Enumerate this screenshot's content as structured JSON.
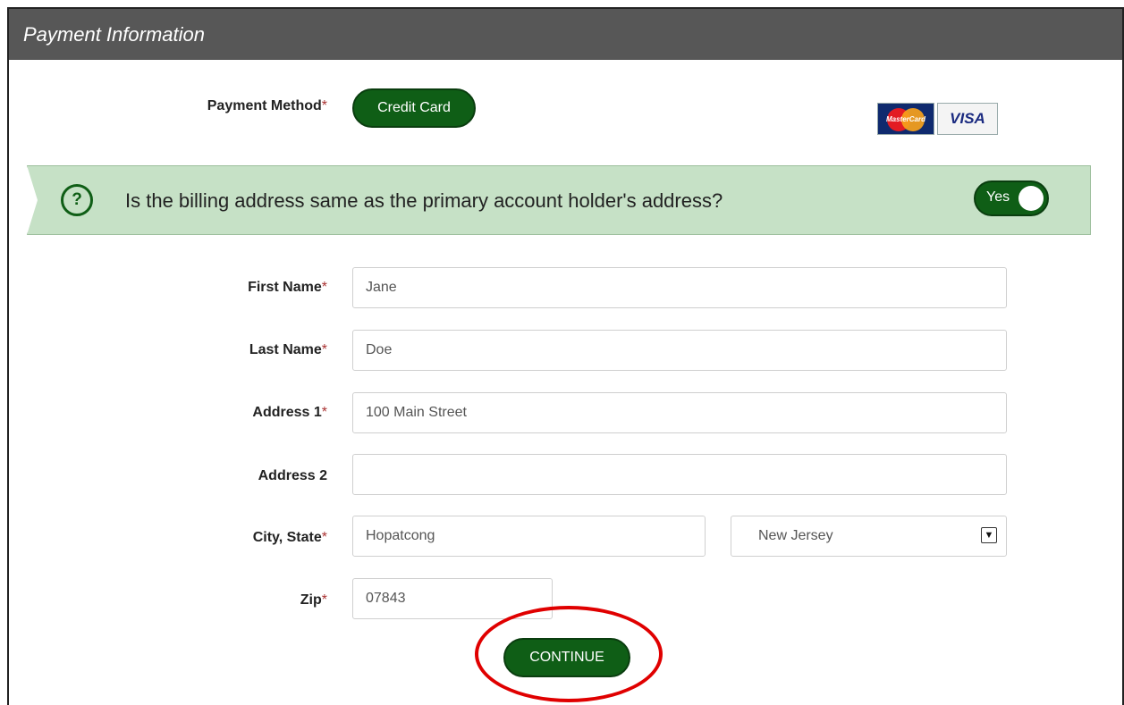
{
  "header": {
    "title": "Payment Information"
  },
  "payment": {
    "method_label": "Payment Method",
    "required_mark": "*",
    "method_value": "Credit Card",
    "cards": {
      "mastercard_text": "MasterCard",
      "visa_text": "VISA"
    }
  },
  "billing_question": {
    "text": "Is the billing address same as the primary account holder's address?",
    "icon_glyph": "?",
    "toggle_label": "Yes"
  },
  "form": {
    "first_name": {
      "label": "First Name",
      "value": "Jane"
    },
    "last_name": {
      "label": "Last Name",
      "value": "Doe"
    },
    "address1": {
      "label": "Address 1",
      "value": "100 Main Street"
    },
    "address2": {
      "label": "Address 2",
      "value": ""
    },
    "city_state": {
      "label": "City, State",
      "city_value": "Hopatcong",
      "state_value": "New Jersey"
    },
    "zip": {
      "label": "Zip",
      "value": "07843"
    }
  },
  "continue_label": "CONTINUE",
  "colors": {
    "header_bg": "#575757",
    "brand_green": "#0f5e16",
    "banner_bg": "#c6e1c6",
    "highlight_ring": "#e00000"
  }
}
